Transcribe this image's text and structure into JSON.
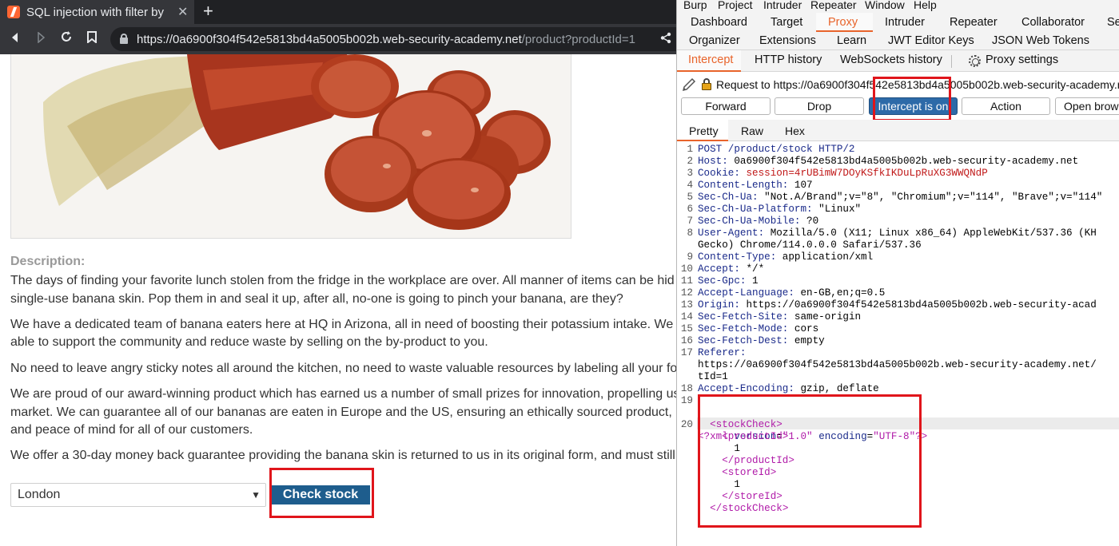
{
  "browser": {
    "tab_title": "SQL injection with filter by",
    "tab_close": "✕",
    "new_tab": "+",
    "url_host": "https://0a6900f304f542e5813bd4a5005b002b.web-security-academy.net",
    "url_path": "/product?productId=1"
  },
  "product": {
    "description_label": "Description:",
    "paragraphs": [
      "The days of finding your favorite lunch stolen from the fridge in the workplace are over. All manner of items can be hid",
      "single-use banana skin. Pop them in and seal it up, after all, no-one is going to pinch your banana, are they?",
      "We have a dedicated team of banana eaters here at HQ in Arizona, all in need of boosting their potassium intake. We",
      "able to support the community and reduce waste by selling on the by-product to you.",
      "No need to leave angry sticky notes all around the kitchen, no need to waste valuable resources by labeling all your fo",
      "We are proud of our award-winning product which has earned us a number of small prizes for innovation, propelling us",
      "market. We can guarantee all of our bananas are eaten in Europe and the US, ensuring an ethically sourced product,",
      "and peace of mind for all of our customers.",
      "We offer a 30-day money back guarantee providing the banana skin is returned to us in its original form, and must still"
    ],
    "store_selected": "London",
    "check_stock_label": "Check stock"
  },
  "burp": {
    "menu": [
      "Burp",
      "Project",
      "Intruder",
      "Repeater",
      "Window",
      "Help"
    ],
    "tools_row1": [
      "Dashboard",
      "Target",
      "Proxy",
      "Intruder",
      "Repeater",
      "Collaborator",
      "Se"
    ],
    "tools_row2": [
      "Organizer",
      "Extensions",
      "Learn",
      "JWT Editor Keys",
      "JSON Web Tokens"
    ],
    "proxy_tabs": [
      "Intercept",
      "HTTP history",
      "WebSockets history",
      "Proxy settings"
    ],
    "request_label": "Request to https://0a6900f304f542e5813bd4a5005b002b.web-security-academy.net:443",
    "buttons": {
      "forward": "Forward",
      "drop": "Drop",
      "intercept": "Intercept is on",
      "action": "Action",
      "open_browser": "Open browser"
    },
    "view_tabs": [
      "Pretty",
      "Raw",
      "Hex"
    ],
    "accent_color": "#e8642b",
    "intercept_color": "#2d6aa8",
    "request_lines": [
      {
        "n": "1",
        "h": "POST /product/stock HTTP/2",
        "v": ""
      },
      {
        "n": "2",
        "h": "Host:",
        "v": " 0a6900f304f542e5813bd4a5005b002b.web-security-academy.net"
      },
      {
        "n": "3",
        "h": "Cookie:",
        "v": " session=4rUBimW7DOyKSfkIKDuLpRuXG3WWQNdP"
      },
      {
        "n": "4",
        "h": "Content-Length:",
        "v": " 107"
      },
      {
        "n": "5",
        "h": "Sec-Ch-Ua:",
        "v": " \"Not.A/Brand\";v=\"8\", \"Chromium\";v=\"114\", \"Brave\";v=\"114\""
      },
      {
        "n": "6",
        "h": "Sec-Ch-Ua-Platform:",
        "v": " \"Linux\""
      },
      {
        "n": "7",
        "h": "Sec-Ch-Ua-Mobile:",
        "v": " ?0"
      },
      {
        "n": "8",
        "h": "User-Agent:",
        "v": " Mozilla/5.0 (X11; Linux x86_64) AppleWebKit/537.36 (KH"
      },
      {
        "n": "",
        "h": "",
        "v": "Gecko) Chrome/114.0.0.0 Safari/537.36"
      },
      {
        "n": "9",
        "h": "Content-Type:",
        "v": " application/xml"
      },
      {
        "n": "10",
        "h": "Accept:",
        "v": " */*"
      },
      {
        "n": "11",
        "h": "Sec-Gpc:",
        "v": " 1"
      },
      {
        "n": "12",
        "h": "Accept-Language:",
        "v": " en-GB,en;q=0.5"
      },
      {
        "n": "13",
        "h": "Origin:",
        "v": " https://0a6900f304f542e5813bd4a5005b002b.web-security-acad"
      },
      {
        "n": "14",
        "h": "Sec-Fetch-Site:",
        "v": " same-origin"
      },
      {
        "n": "15",
        "h": "Sec-Fetch-Mode:",
        "v": " cors"
      },
      {
        "n": "16",
        "h": "Sec-Fetch-Dest:",
        "v": " empty"
      },
      {
        "n": "17",
        "h": "Referer:",
        "v": ""
      },
      {
        "n": "",
        "h": "",
        "v": "https://0a6900f304f542e5813bd4a5005b002b.web-security-academy.net/"
      },
      {
        "n": "",
        "h": "",
        "v": "tId=1"
      },
      {
        "n": "18",
        "h": "Accept-Encoding:",
        "v": " gzip, deflate"
      },
      {
        "n": "19",
        "h": "",
        "v": ""
      }
    ],
    "xml_decl": {
      "n": "20",
      "pre": "<?xml ",
      "a1": "version",
      "v1": "\"1.0\"",
      "a2": "encoding",
      "v2": "\"UTF-8\"",
      "post": "?>"
    },
    "xml_lines": [
      {
        "indent": "  ",
        "text": "<stockCheck>",
        "tag": true
      },
      {
        "indent": "    ",
        "text": "<productId>",
        "tag": true
      },
      {
        "indent": "      ",
        "text": "1",
        "tag": false
      },
      {
        "indent": "    ",
        "text": "</productId>",
        "tag": true
      },
      {
        "indent": "    ",
        "text": "<storeId>",
        "tag": true
      },
      {
        "indent": "      ",
        "text": "1",
        "tag": false
      },
      {
        "indent": "    ",
        "text": "</storeId>",
        "tag": true
      },
      {
        "indent": "  ",
        "text": "</stockCheck>",
        "tag": true
      }
    ]
  }
}
